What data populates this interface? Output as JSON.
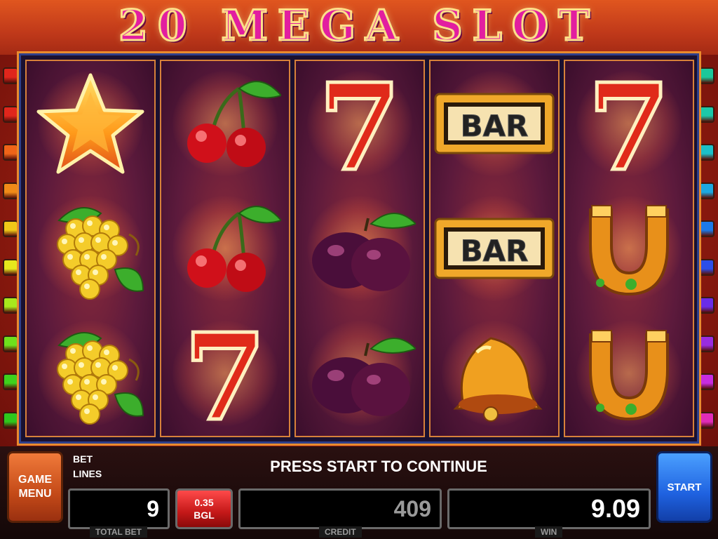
{
  "title": "20 MEGA SLOT",
  "reels": [
    [
      "star",
      "grapes",
      "grapes"
    ],
    [
      "cherry",
      "cherry",
      "seven"
    ],
    [
      "seven",
      "plum",
      "plum"
    ],
    [
      "bar",
      "bar",
      "bell"
    ],
    [
      "seven",
      "horseshoe",
      "horseshoe"
    ]
  ],
  "symbol_text": {
    "bar": "BAR",
    "seven": "7"
  },
  "line_colors_left": [
    "#e0261c",
    "#e0261c",
    "#f06418",
    "#f08a18",
    "#f0c818",
    "#e6e81c",
    "#a8e81c",
    "#6ee01c",
    "#3ed21c",
    "#2ec81c"
  ],
  "line_colors_right": [
    "#1cc89a",
    "#1cc8a8",
    "#1cc0c8",
    "#1ca8e0",
    "#1c7ae8",
    "#2c4ee8",
    "#6a2ce8",
    "#9a2ce0",
    "#c82ce0",
    "#e02cb8"
  ],
  "buttons": {
    "menu_line1": "GAME",
    "menu_line2": "MENU",
    "start": "START",
    "denom_value": "0.35",
    "denom_currency": "BGL"
  },
  "labels": {
    "bet": "BET",
    "lines": "LINES",
    "total_bet": "TOTAL BET",
    "credit": "CREDIT",
    "win": "WIN"
  },
  "message": "PRESS START TO CONTINUE",
  "values": {
    "total_bet": "9",
    "credit": "409",
    "win": "9.09"
  }
}
